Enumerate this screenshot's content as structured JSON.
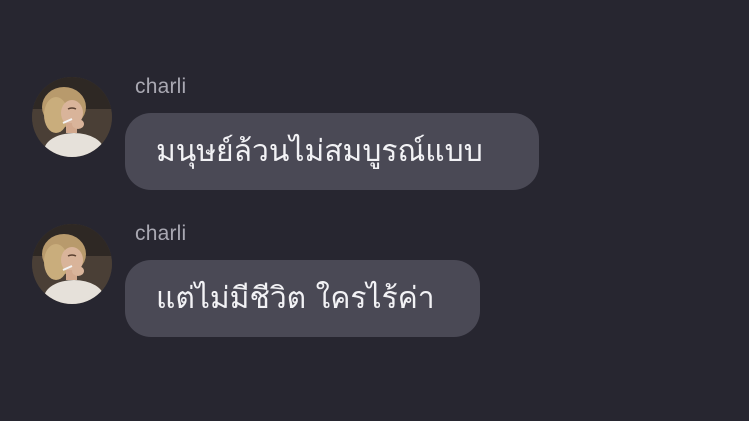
{
  "conversation": {
    "messages": [
      {
        "sender": "charli",
        "text": "มนุษย์ล้วนไม่สมบูรณ์แบบ",
        "avatar": "profile-photo"
      },
      {
        "sender": "charli",
        "text": "แต่ไม่มีชีวิต ใครไร้ค่า",
        "avatar": "profile-photo"
      }
    ]
  },
  "colors": {
    "background": "#272630",
    "bubble": "#4a4955",
    "sender_name": "#a9a8b2",
    "message_text": "#f2f2f5"
  }
}
